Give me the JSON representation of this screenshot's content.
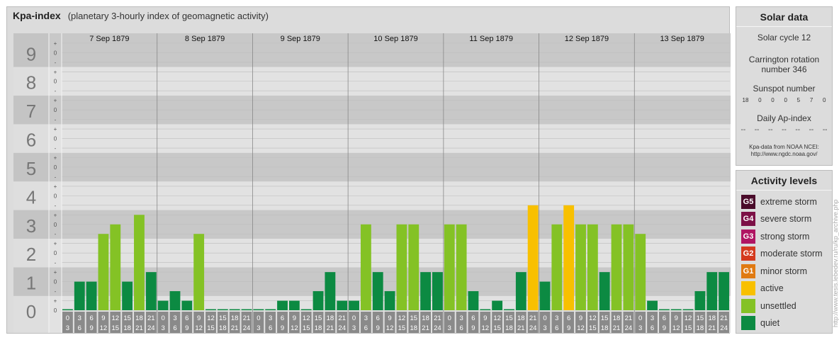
{
  "title": {
    "main": "Kpa-index",
    "subtitle": "(planetary 3-hourly index of geomagnetic activity)"
  },
  "chart_data": {
    "type": "bar",
    "days": [
      "7 Sep 1879",
      "8 Sep 1879",
      "9 Sep 1879",
      "10 Sep 1879",
      "11 Sep 1879",
      "12 Sep 1879",
      "13 Sep 1879"
    ],
    "interval_labels": [
      [
        "0",
        "3"
      ],
      [
        "3",
        "6"
      ],
      [
        "6",
        "9"
      ],
      [
        "9",
        "12"
      ],
      [
        "12",
        "15"
      ],
      [
        "15",
        "18"
      ],
      [
        "18",
        "21"
      ],
      [
        "21",
        "24"
      ]
    ],
    "y_labels": [
      "0",
      "1",
      "2",
      "3",
      "4",
      "5",
      "6",
      "7",
      "8",
      "9"
    ],
    "minor_labels": [
      "0",
      "+",
      "-"
    ],
    "ylim": [
      0,
      9.33
    ],
    "values": [
      0,
      1,
      1,
      2.667,
      3,
      1,
      3.333,
      1.333,
      0.333,
      0.667,
      0.333,
      2.667,
      0,
      0,
      0,
      0,
      0,
      0,
      0.333,
      0.333,
      0,
      0.667,
      1.333,
      0.333,
      0.333,
      3,
      1.333,
      0.667,
      3,
      3,
      1.333,
      1.333,
      3,
      3,
      0.667,
      0,
      0.333,
      0,
      1.333,
      3.667,
      1,
      3,
      3.667,
      3,
      3,
      1.333,
      3,
      3,
      2.667,
      0.333,
      0,
      0,
      0,
      0.667,
      1.333,
      1.333
    ],
    "colors": {
      "quiet": "#0c8a42",
      "unsettled": "#84c225",
      "active": "#f8c000",
      "band_dark": "#c8c8c8",
      "band_light": "#e2e2e2"
    }
  },
  "solar": {
    "title": "Solar data",
    "cycle": "Solar cycle 12",
    "rotation": "Carrington rotation number 346",
    "sunspot_label": "Sunspot number",
    "sunspot_values": [
      "18",
      "0",
      "0",
      "0",
      "5",
      "7",
      "0"
    ],
    "ap_label": "Daily Ap-index",
    "ap_values": [
      "--",
      "--",
      "--",
      "--",
      "--",
      "--",
      "--"
    ],
    "source_line1": "Kpa-data from NOAA NCEI:",
    "source_line2": "http://www.ngdc.noaa.gov/"
  },
  "activity": {
    "title": "Activity levels",
    "levels": [
      {
        "code": "G5",
        "label": "extreme storm",
        "color": "#4a0b2a"
      },
      {
        "code": "G4",
        "label": "severe storm",
        "color": "#7c1046"
      },
      {
        "code": "G3",
        "label": "strong storm",
        "color": "#b01563"
      },
      {
        "code": "G2",
        "label": "moderate storm",
        "color": "#d43a1e"
      },
      {
        "code": "G1",
        "label": "minor storm",
        "color": "#e07a12"
      },
      {
        "code": "",
        "label": "active",
        "color": "#f8c000"
      },
      {
        "code": "",
        "label": "unsettled",
        "color": "#84c225"
      },
      {
        "code": "",
        "label": "quiet",
        "color": "#0c8a42"
      }
    ]
  },
  "watermark": "http://www.tesis.lebedev.ru/ru/kp_archive.php"
}
